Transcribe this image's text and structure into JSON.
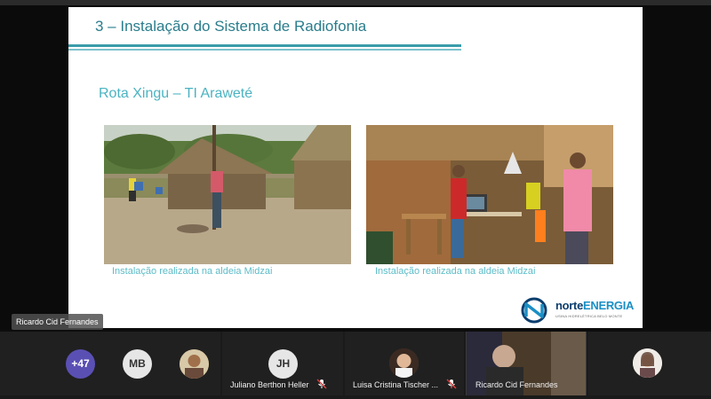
{
  "slide": {
    "title": "3 – Instalação do Sistema de Radiofonia",
    "subtitle": "Rota Xingu – TI Araweté",
    "captions": [
      "Instalação realizada na aldeia Midzai",
      "Instalação realizada na aldeia Midzai"
    ],
    "logo": {
      "name_part1": "norte",
      "name_part2": "ENERGIA",
      "tagline": "USINA HIDRELÉTRICA BELO MONTE"
    }
  },
  "presenter": {
    "name": "Ricardo Cid Fernandes"
  },
  "participants": {
    "overflow_count": "+47",
    "tiles": [
      {
        "initials": "MB"
      },
      {
        "initials": "JH",
        "name": "Juliano Berthon Heller"
      },
      {
        "name": "Luisa Cristina Tischer ..."
      },
      {
        "name": "Ricardo Cid Fernandes"
      }
    ]
  },
  "colors": {
    "title": "#2a7d8c",
    "caption": "#5cbcc8",
    "tile_bg": "#202020",
    "selected_tile_bg": "#3a3a3a"
  }
}
